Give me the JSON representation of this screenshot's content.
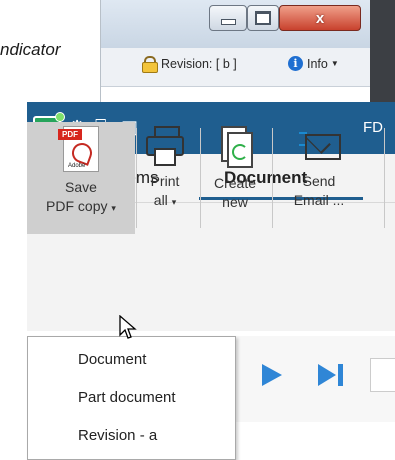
{
  "caption": "ndicator",
  "window": {
    "revision_text": "Revision: [ b ]",
    "info_label": "Info",
    "close_symbol": "x"
  },
  "app": {
    "title": "FD",
    "tabs": [
      {
        "label": "Items"
      },
      {
        "label": "Document"
      }
    ],
    "ribbon": {
      "save": {
        "line1": "Save",
        "line2": "PDF copy",
        "caret": "▾"
      },
      "print": {
        "line1": "Print",
        "line2": "all",
        "caret": "▾"
      },
      "create": {
        "line1": "Create",
        "line2": "new"
      },
      "send": {
        "line1": "Send",
        "line2": "Email ..."
      }
    },
    "pdf_badge": "PDF",
    "pdf_brand": "Adobe"
  },
  "dropdown": {
    "items": [
      "Document",
      "Part document",
      "Revision - a"
    ]
  },
  "colors": {
    "titlebar": "#1f5e8f",
    "accent_blue": "#2f86d6",
    "logo_green": "#26a45b"
  }
}
